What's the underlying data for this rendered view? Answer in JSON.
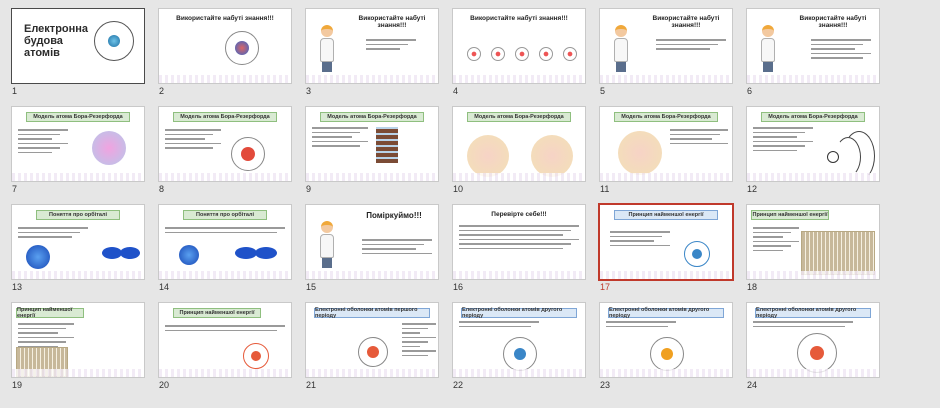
{
  "slides": [
    {
      "num": "1",
      "title": "Електронна будова атомів"
    },
    {
      "num": "2",
      "title": "Використайте набуті знання!!!"
    },
    {
      "num": "3",
      "title": "Використайте набуті знання!!!"
    },
    {
      "num": "4",
      "title": "Використайте набуті знання!!!"
    },
    {
      "num": "5",
      "title": "Використайте набуті знання!!!"
    },
    {
      "num": "6",
      "title": "Використайте набуті знання!!!"
    },
    {
      "num": "7",
      "title": "Модель атома Бора-Резерфорда"
    },
    {
      "num": "8",
      "title": "Модель атома Бора-Резерфорда"
    },
    {
      "num": "9",
      "title": "Модель атома Бора-Резерфорда"
    },
    {
      "num": "10",
      "title": "Модель атома Бора-Резерфорда"
    },
    {
      "num": "11",
      "title": "Модель атома Бора-Резерфорда"
    },
    {
      "num": "12",
      "title": "Модель атома Бора-Резерфорда"
    },
    {
      "num": "13",
      "title": "Поняття про орбіталі"
    },
    {
      "num": "14",
      "title": "Поняття про орбіталі"
    },
    {
      "num": "15",
      "title": "Поміркуймо!!!"
    },
    {
      "num": "16",
      "title": "Перевірте себе!!!"
    },
    {
      "num": "17",
      "title": "Принцип найменшої енергії"
    },
    {
      "num": "18",
      "title": "Принцип найменшої енергії"
    },
    {
      "num": "19",
      "title": "Принцип найменшої енергії"
    },
    {
      "num": "20",
      "title": "Принцип найменшої енергії"
    },
    {
      "num": "21",
      "title": "Електронні оболонки атомів першого періоду"
    },
    {
      "num": "22",
      "title": "Електронні оболонки атомів другого періоду"
    },
    {
      "num": "23",
      "title": "Електронні оболонки атомів другого періоду"
    },
    {
      "num": "24",
      "title": "Електронні оболонки атомів другого періоду"
    }
  ],
  "selected_slide": "17",
  "colors": {
    "selection": "#c0392b",
    "banner_green": "#d9ead3",
    "banner_blue": "#dbe8f6"
  }
}
